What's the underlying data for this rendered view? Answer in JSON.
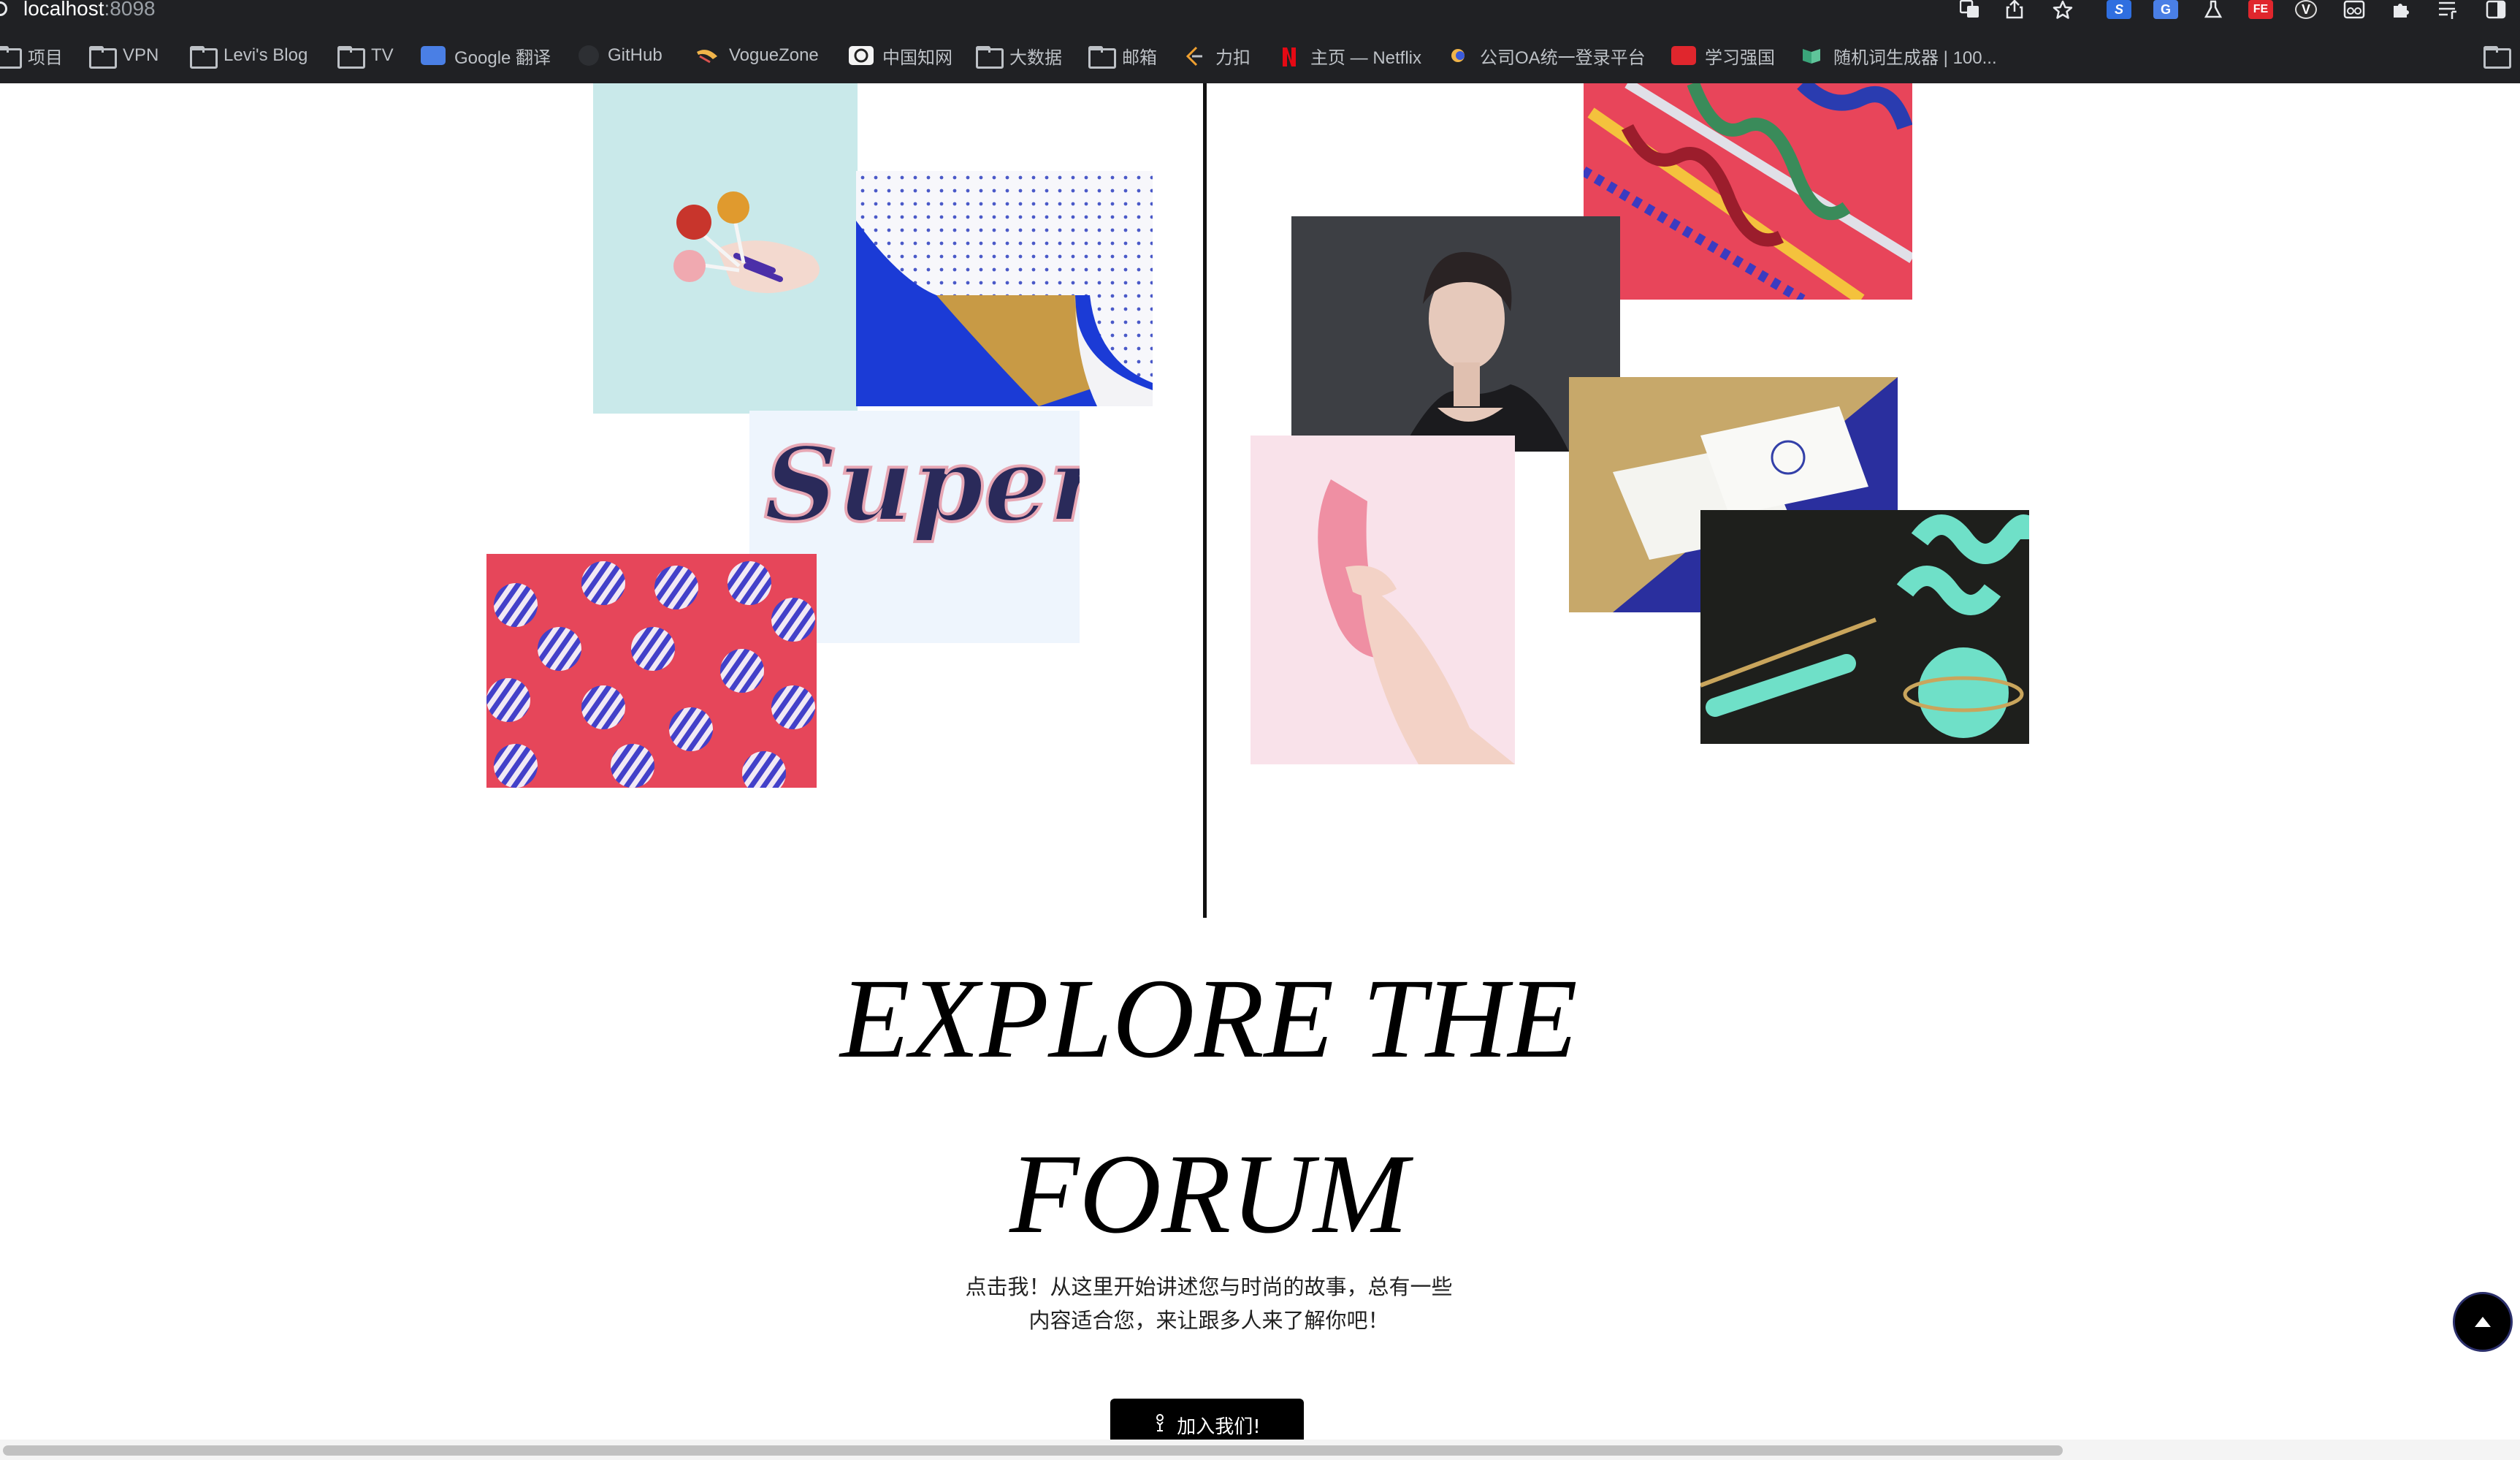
{
  "browser": {
    "url_host": "localhost",
    "url_port": ":8098",
    "toolbar_icons": [
      "translate-icon",
      "share-icon",
      "star-icon",
      "sogou-extension-icon",
      "google-translate-extension-icon",
      "flask-extension-icon",
      "fe-helper-extension-icon",
      "vue-devtools-extension-icon",
      "reader-extension-icon",
      "puzzle-extension-icon",
      "reading-list-icon",
      "side-panel-icon"
    ],
    "bookmarks": [
      {
        "label": "项目",
        "icon": "folder-icon"
      },
      {
        "label": "VPN",
        "icon": "folder-icon"
      },
      {
        "label": "Levi's Blog",
        "icon": "folder-icon"
      },
      {
        "label": "TV",
        "icon": "folder-icon"
      },
      {
        "label": "Google 翻译",
        "icon": "google-translate-icon"
      },
      {
        "label": "GitHub",
        "icon": "github-icon"
      },
      {
        "label": "VogueZone",
        "icon": "voguezone-icon"
      },
      {
        "label": "中国知网",
        "icon": "cnki-icon"
      },
      {
        "label": "大数据",
        "icon": "folder-icon"
      },
      {
        "label": "邮箱",
        "icon": "folder-icon"
      },
      {
        "label": "力扣",
        "icon": "leetcode-icon"
      },
      {
        "label": "主页 — Netflix",
        "icon": "netflix-icon"
      },
      {
        "label": "公司OA统一登录平台",
        "icon": "oa-icon"
      },
      {
        "label": "学习强国",
        "icon": "xuexi-icon"
      },
      {
        "label": "随机词生成器 | 100...",
        "icon": "generator-icon"
      }
    ]
  },
  "hero": {
    "headline_line1": "EXPLORE THE",
    "headline_line2": "FORUM",
    "subtitle_line1": "点击我！从这里开始讲述您与时尚的故事，总有一些",
    "subtitle_line2": "内容适合您，来让跟多人来了解你吧！",
    "join_button": "加入我们!",
    "join_icon": "person-icon"
  },
  "collage": {
    "left": [
      "lollipop-hand-photo",
      "peeled-dots-paper-photo",
      "super-lettering-photo",
      "striped-candy-balls-photo"
    ],
    "right": [
      "glossy-tubes-photo",
      "vintage-woman-portrait-photo",
      "pink-banana-hand-photo",
      "business-cards-photo",
      "mint-spiral-objects-photo"
    ]
  },
  "colors": {
    "chrome_bg": "#202124",
    "accent": "#000000",
    "coral": "#e8455a",
    "royal_blue": "#1b3bd6",
    "mint": "#6fe0c8",
    "light_cyan": "#c9e9ea"
  }
}
